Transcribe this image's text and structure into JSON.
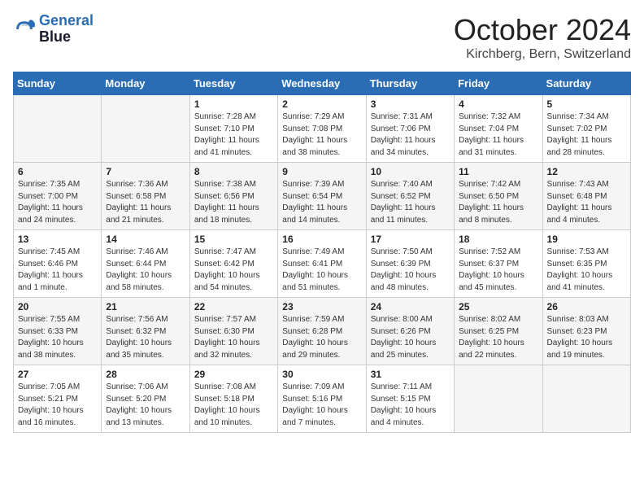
{
  "header": {
    "logo_line1": "General",
    "logo_line2": "Blue",
    "month_title": "October 2024",
    "location": "Kirchberg, Bern, Switzerland"
  },
  "weekdays": [
    "Sunday",
    "Monday",
    "Tuesday",
    "Wednesday",
    "Thursday",
    "Friday",
    "Saturday"
  ],
  "weeks": [
    [
      {
        "day": "",
        "detail": ""
      },
      {
        "day": "",
        "detail": ""
      },
      {
        "day": "1",
        "detail": "Sunrise: 7:28 AM\nSunset: 7:10 PM\nDaylight: 11 hours and 41 minutes."
      },
      {
        "day": "2",
        "detail": "Sunrise: 7:29 AM\nSunset: 7:08 PM\nDaylight: 11 hours and 38 minutes."
      },
      {
        "day": "3",
        "detail": "Sunrise: 7:31 AM\nSunset: 7:06 PM\nDaylight: 11 hours and 34 minutes."
      },
      {
        "day": "4",
        "detail": "Sunrise: 7:32 AM\nSunset: 7:04 PM\nDaylight: 11 hours and 31 minutes."
      },
      {
        "day": "5",
        "detail": "Sunrise: 7:34 AM\nSunset: 7:02 PM\nDaylight: 11 hours and 28 minutes."
      }
    ],
    [
      {
        "day": "6",
        "detail": "Sunrise: 7:35 AM\nSunset: 7:00 PM\nDaylight: 11 hours and 24 minutes."
      },
      {
        "day": "7",
        "detail": "Sunrise: 7:36 AM\nSunset: 6:58 PM\nDaylight: 11 hours and 21 minutes."
      },
      {
        "day": "8",
        "detail": "Sunrise: 7:38 AM\nSunset: 6:56 PM\nDaylight: 11 hours and 18 minutes."
      },
      {
        "day": "9",
        "detail": "Sunrise: 7:39 AM\nSunset: 6:54 PM\nDaylight: 11 hours and 14 minutes."
      },
      {
        "day": "10",
        "detail": "Sunrise: 7:40 AM\nSunset: 6:52 PM\nDaylight: 11 hours and 11 minutes."
      },
      {
        "day": "11",
        "detail": "Sunrise: 7:42 AM\nSunset: 6:50 PM\nDaylight: 11 hours and 8 minutes."
      },
      {
        "day": "12",
        "detail": "Sunrise: 7:43 AM\nSunset: 6:48 PM\nDaylight: 11 hours and 4 minutes."
      }
    ],
    [
      {
        "day": "13",
        "detail": "Sunrise: 7:45 AM\nSunset: 6:46 PM\nDaylight: 11 hours and 1 minute."
      },
      {
        "day": "14",
        "detail": "Sunrise: 7:46 AM\nSunset: 6:44 PM\nDaylight: 10 hours and 58 minutes."
      },
      {
        "day": "15",
        "detail": "Sunrise: 7:47 AM\nSunset: 6:42 PM\nDaylight: 10 hours and 54 minutes."
      },
      {
        "day": "16",
        "detail": "Sunrise: 7:49 AM\nSunset: 6:41 PM\nDaylight: 10 hours and 51 minutes."
      },
      {
        "day": "17",
        "detail": "Sunrise: 7:50 AM\nSunset: 6:39 PM\nDaylight: 10 hours and 48 minutes."
      },
      {
        "day": "18",
        "detail": "Sunrise: 7:52 AM\nSunset: 6:37 PM\nDaylight: 10 hours and 45 minutes."
      },
      {
        "day": "19",
        "detail": "Sunrise: 7:53 AM\nSunset: 6:35 PM\nDaylight: 10 hours and 41 minutes."
      }
    ],
    [
      {
        "day": "20",
        "detail": "Sunrise: 7:55 AM\nSunset: 6:33 PM\nDaylight: 10 hours and 38 minutes."
      },
      {
        "day": "21",
        "detail": "Sunrise: 7:56 AM\nSunset: 6:32 PM\nDaylight: 10 hours and 35 minutes."
      },
      {
        "day": "22",
        "detail": "Sunrise: 7:57 AM\nSunset: 6:30 PM\nDaylight: 10 hours and 32 minutes."
      },
      {
        "day": "23",
        "detail": "Sunrise: 7:59 AM\nSunset: 6:28 PM\nDaylight: 10 hours and 29 minutes."
      },
      {
        "day": "24",
        "detail": "Sunrise: 8:00 AM\nSunset: 6:26 PM\nDaylight: 10 hours and 25 minutes."
      },
      {
        "day": "25",
        "detail": "Sunrise: 8:02 AM\nSunset: 6:25 PM\nDaylight: 10 hours and 22 minutes."
      },
      {
        "day": "26",
        "detail": "Sunrise: 8:03 AM\nSunset: 6:23 PM\nDaylight: 10 hours and 19 minutes."
      }
    ],
    [
      {
        "day": "27",
        "detail": "Sunrise: 7:05 AM\nSunset: 5:21 PM\nDaylight: 10 hours and 16 minutes."
      },
      {
        "day": "28",
        "detail": "Sunrise: 7:06 AM\nSunset: 5:20 PM\nDaylight: 10 hours and 13 minutes."
      },
      {
        "day": "29",
        "detail": "Sunrise: 7:08 AM\nSunset: 5:18 PM\nDaylight: 10 hours and 10 minutes."
      },
      {
        "day": "30",
        "detail": "Sunrise: 7:09 AM\nSunset: 5:16 PM\nDaylight: 10 hours and 7 minutes."
      },
      {
        "day": "31",
        "detail": "Sunrise: 7:11 AM\nSunset: 5:15 PM\nDaylight: 10 hours and 4 minutes."
      },
      {
        "day": "",
        "detail": ""
      },
      {
        "day": "",
        "detail": ""
      }
    ]
  ]
}
